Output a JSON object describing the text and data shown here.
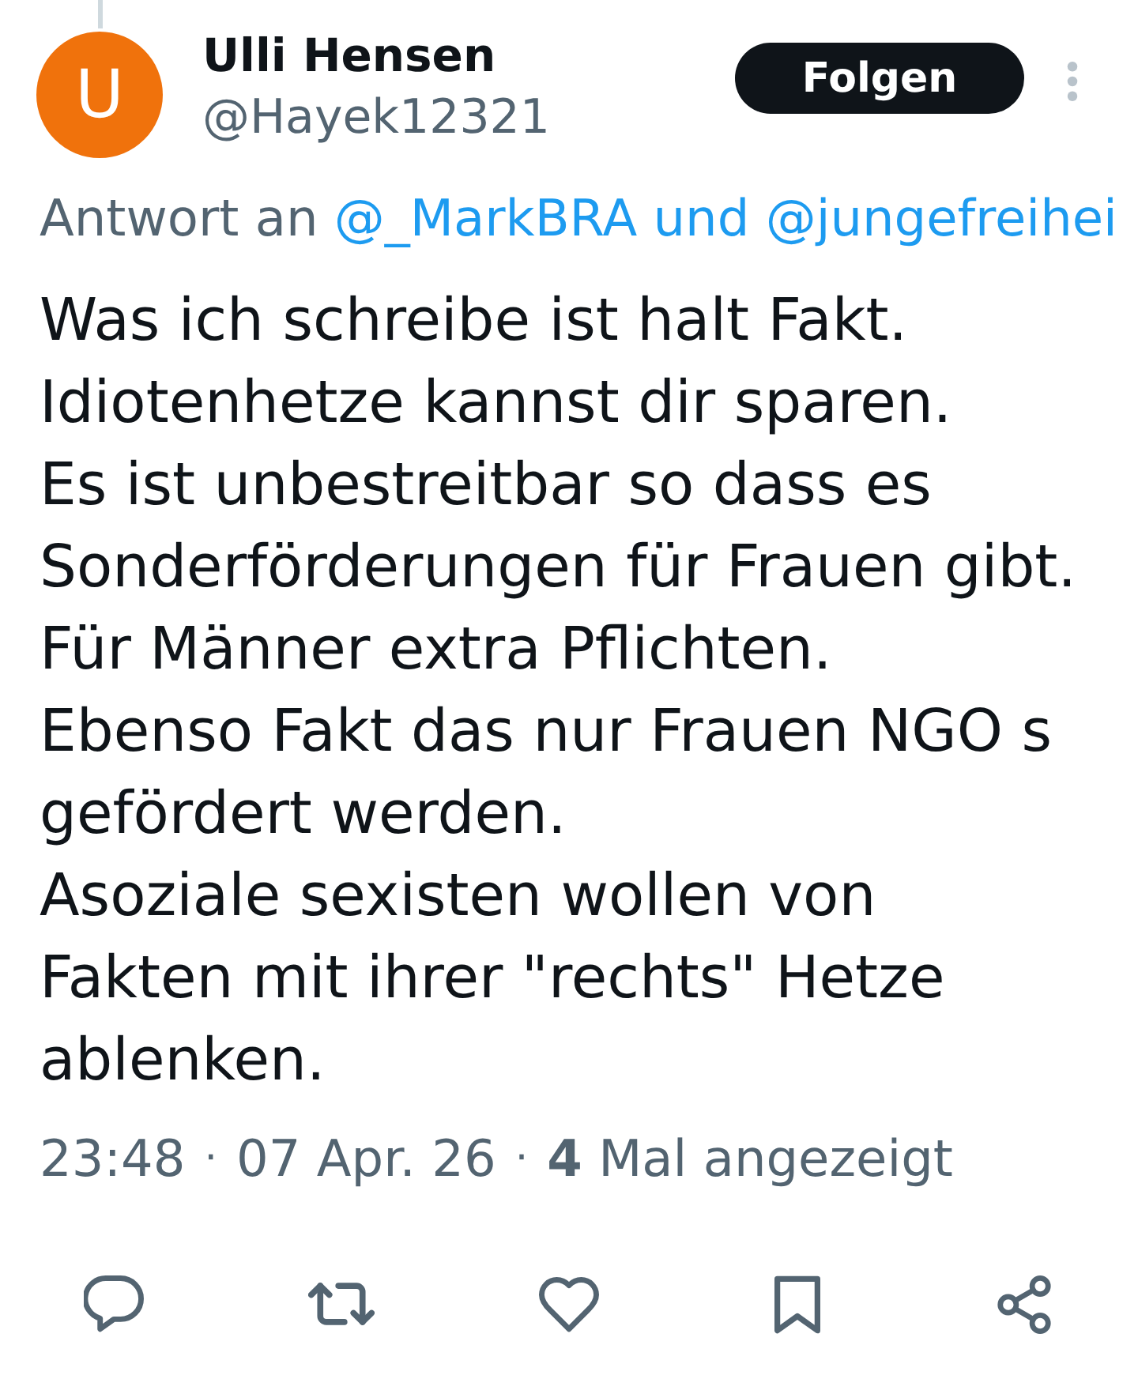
{
  "author": {
    "avatar_letter": "U",
    "name": "Ulli Hensen",
    "handle": "@Hayek12321"
  },
  "follow_button": {
    "label": "Folgen"
  },
  "reply_context": {
    "prefix": "Antwort an",
    "recipients": "@_MarkBRA und @jungefreihei"
  },
  "tweet_text": "Was ich schreibe ist halt Fakt.\nIdiotenhetze kannst dir sparen.\nEs ist unbestreitbar so dass es\nSonderförderungen für Frauen gibt.\nFür Männer extra Pflichten.\nEbenso Fakt das nur Frauen NGO s\ngefördert werden.\nAsoziale sexisten wollen von\nFakten mit ihrer \"rechts\" Hetze\nablenken.",
  "meta": {
    "time": "23:48",
    "date": "07 Apr. 26",
    "views": "**4** Mal angezeigt",
    "separators": [
      "·",
      "·"
    ]
  }
}
